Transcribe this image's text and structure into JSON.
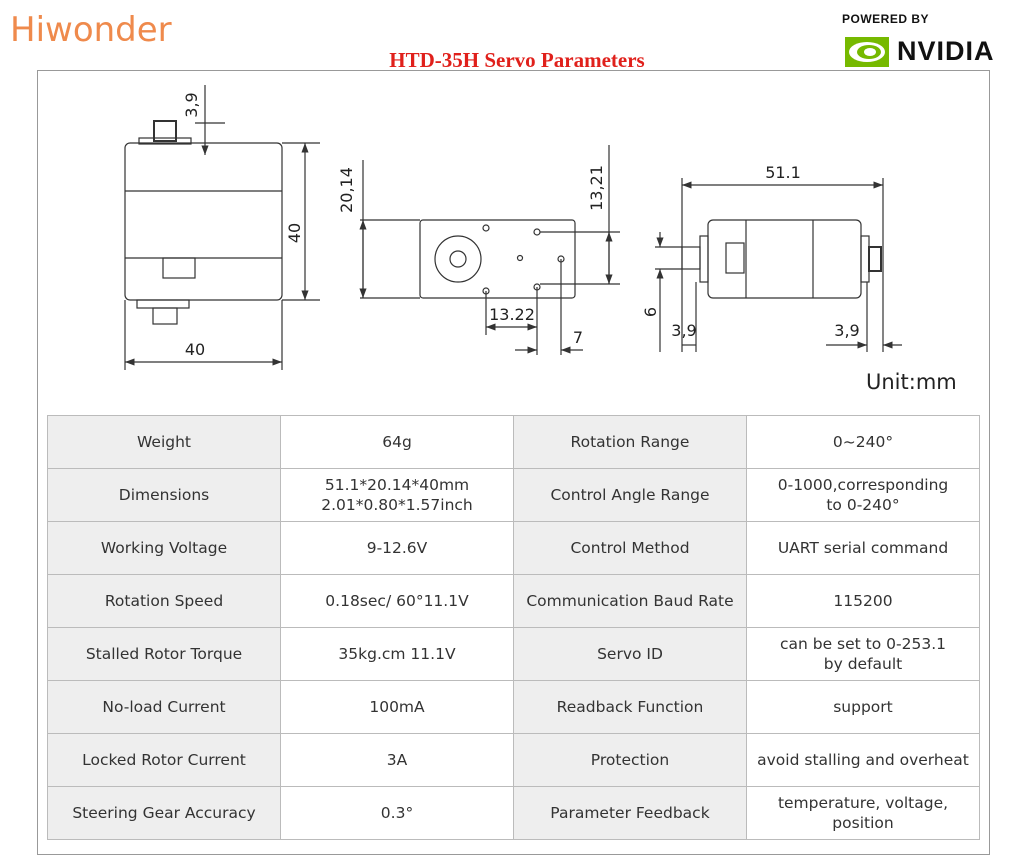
{
  "header": {
    "brand": "Hiwonder",
    "title": "HTD-35H Servo Parameters",
    "powered_by": "POWERED BY",
    "partner": "NVIDIA",
    "brand_color": "#ef8a4c",
    "title_color": "#e0201b",
    "partner_color": "#76b900"
  },
  "drawing": {
    "front_top_offset": "3,9",
    "front_height": "40",
    "front_width": "40",
    "bottom_height": "20,14",
    "bottom_hole_spacing_v": "13,21",
    "bottom_hole_spacing_h": "13.22",
    "bottom_edge_offset": "7",
    "side_length": "51.1",
    "side_shaft": "6",
    "side_left_offset": "3,9",
    "side_right_offset": "3,9",
    "unit": "Unit:mm"
  },
  "specs": [
    {
      "label1": "Weight",
      "value1": "64g",
      "label2": "Rotation Range",
      "value2": "0~240°"
    },
    {
      "label1": "Dimensions",
      "value1": "51.1*20.14*40mm\n2.01*0.80*1.57inch",
      "label2": "Control Angle Range",
      "value2": "0-1000,corresponding\nto 0-240°"
    },
    {
      "label1": "Working Voltage",
      "value1": "9-12.6V",
      "label2": "Control Method",
      "value2": "UART serial command"
    },
    {
      "label1": "Rotation Speed",
      "value1": "0.18sec/ 60°11.1V",
      "label2": "Communication Baud Rate",
      "value2": "115200"
    },
    {
      "label1": "Stalled Rotor Torque",
      "value1": "35kg.cm 11.1V",
      "label2": "Servo ID",
      "value2": "can be set to 0-253.1\nby default"
    },
    {
      "label1": "No-load Current",
      "value1": "100mA",
      "label2": "Readback Function",
      "value2": "support"
    },
    {
      "label1": "Locked Rotor Current",
      "value1": "3A",
      "label2": "Protection",
      "value2": "avoid stalling and overheat"
    },
    {
      "label1": "Steering Gear Accuracy",
      "value1": "0.3°",
      "label2": "Parameter Feedback",
      "value2": "temperature, voltage,\nposition"
    }
  ]
}
